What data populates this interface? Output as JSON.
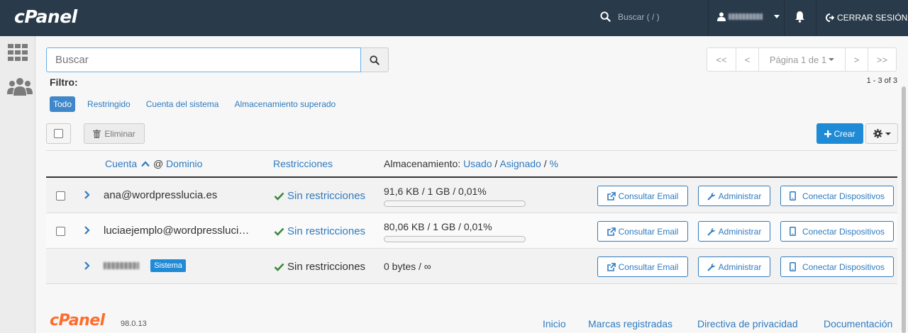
{
  "topbar": {
    "logo": "cPanel",
    "search_placeholder": "Buscar ( / )",
    "logout_label": "CERRAR SESIÓN"
  },
  "search": {
    "placeholder": "Buscar"
  },
  "pagination": {
    "first": "<<",
    "prev": "<",
    "page_label": "Página 1 de 1",
    "next": ">",
    "last": ">>",
    "range": "1 - 3 of 3"
  },
  "filter": {
    "label": "Filtro:",
    "options": [
      "Todo",
      "Restringido",
      "Cuenta del sistema",
      "Almacenamiento superado"
    ],
    "active": "Todo"
  },
  "toolbar": {
    "delete_label": "Eliminar",
    "create_label": "Crear"
  },
  "table": {
    "headers": {
      "account": "Cuenta",
      "at": "@",
      "domain": "Dominio",
      "restrictions": "Restricciones",
      "storage": "Almacenamiento:",
      "used": "Usado",
      "slash1": "/",
      "assigned": "Asignado",
      "slash2": "/",
      "percent": "%"
    },
    "rows": [
      {
        "account": "ana@wordpresslucia.es",
        "restrictions": "Sin restricciones",
        "storage": "91,6 KB / 1 GB / 0,01%",
        "usage_percent": 0.01
      },
      {
        "account": "luciaejemplo@wordpressluci…",
        "restrictions": "Sin restricciones",
        "storage": "80,06 KB / 1 GB / 0,01%",
        "usage_percent": 0.01
      },
      {
        "account": "",
        "badge": "Sistema",
        "restrictions": "Sin restricciones",
        "storage": "0 bytes / ∞"
      }
    ],
    "actions": {
      "email": "Consultar Email",
      "manage": "Administrar",
      "devices": "Conectar Dispositivos"
    }
  },
  "footer": {
    "logo": "cPanel",
    "version": "98.0.13",
    "links": [
      "Inicio",
      "Marcas registradas",
      "Directiva de privacidad",
      "Documentación"
    ]
  },
  "colors": {
    "topbar": "#293a4a",
    "accent": "#1f8ad6",
    "link": "#2f7bbf",
    "brand_orange": "#ff6c2c",
    "success": "#3a8a3a"
  }
}
